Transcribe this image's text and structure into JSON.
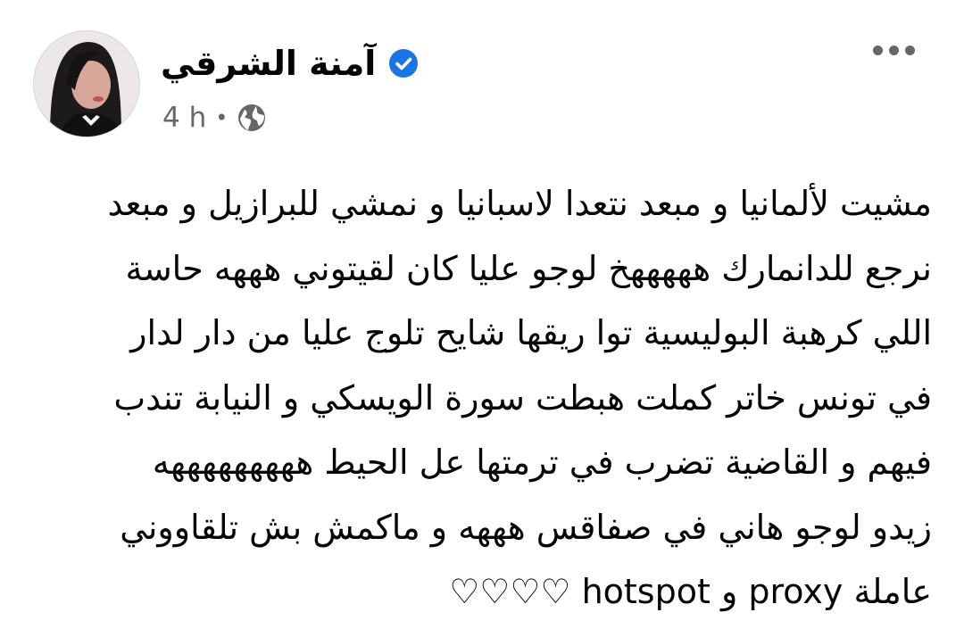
{
  "post": {
    "author": {
      "name": "آمنة الشرقي",
      "verified": true
    },
    "time": "4 h",
    "separator": "•",
    "audience_icon": "globe-icon",
    "more_icon": "more-options-icon",
    "lines": [
      "مشيت لألمانيا و مبعد نتعدا لاسبانيا و نمشي للبرازيل و مبعد",
      "نرجع للدانمارك هههههخ لوجو عليا كان لقيتوني هههه حاسة",
      "اللي كرهبة البوليسية توا ريقها شايح تلوج عليا من دار لدار",
      "في تونس  خاتر كملت هبطت سورة الويسكي و النيابة تندب",
      "فيهم و القاضية تضرب في ترمتها عل الحيط هههههههههه",
      "زيدو لوجو هاني في صفاقس هههه و ماكمش بش تلقاووني",
      "عاملة proxy و hotspot ♡♡♡♡"
    ]
  },
  "colors": {
    "text": "#050505",
    "meta": "#65676b",
    "verified": "#1b74e4",
    "background": "#ffffff"
  }
}
